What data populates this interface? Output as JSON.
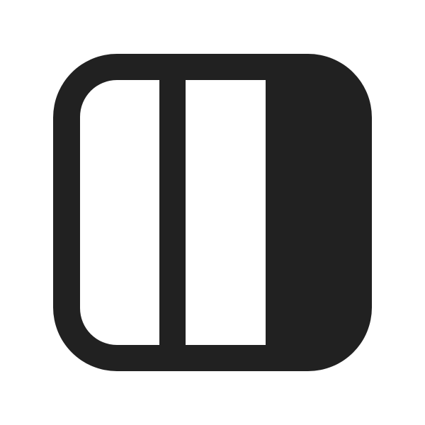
{
  "icon": {
    "name": "three-column-layout-icon",
    "variant": "right-column-filled",
    "colors": {
      "foreground": "#212121",
      "background": "#ffffff"
    }
  }
}
